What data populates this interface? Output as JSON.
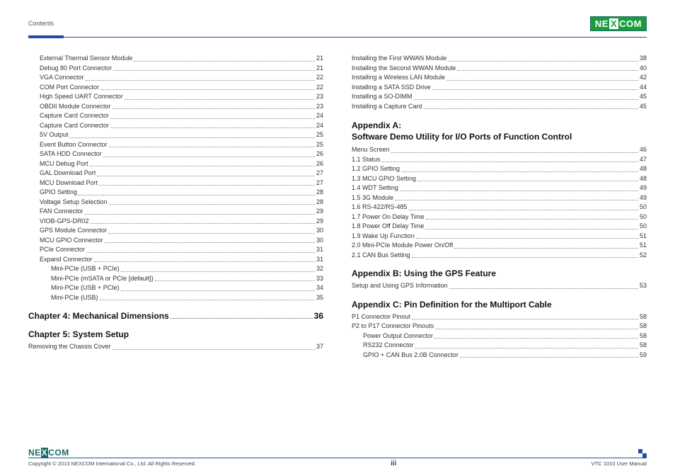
{
  "header": {
    "contents_label": "Contents",
    "brand": "NEXCOM"
  },
  "left_col": {
    "items": [
      {
        "label": "External Thermal Sensor Module",
        "page": "21",
        "indent": 1
      },
      {
        "label": "Debug 80 Port Connector",
        "page": "21",
        "indent": 1
      },
      {
        "label": "VGA Connector",
        "page": "22",
        "indent": 1
      },
      {
        "label": "COM Port Connector",
        "page": "22",
        "indent": 1
      },
      {
        "label": "High Speed UART Connector",
        "page": "23",
        "indent": 1
      },
      {
        "label": "OBDII Module Connector",
        "page": "23",
        "indent": 1
      },
      {
        "label": "Capture Card Connector",
        "page": "24",
        "indent": 1
      },
      {
        "label": "Capture Card Connector",
        "page": "24",
        "indent": 1
      },
      {
        "label": "5V Output",
        "page": "25",
        "indent": 1
      },
      {
        "label": "Event Button Connector",
        "page": "25",
        "indent": 1
      },
      {
        "label": "SATA HDD Connector",
        "page": "26",
        "indent": 1
      },
      {
        "label": "MCU Debug Port",
        "page": "26",
        "indent": 1
      },
      {
        "label": "GAL Download Port",
        "page": "27",
        "indent": 1
      },
      {
        "label": "MCU Download Port",
        "page": "27",
        "indent": 1
      },
      {
        "label": "GPIO Setting",
        "page": "28",
        "indent": 1
      },
      {
        "label": "Voltage Setup Selection",
        "page": "28",
        "indent": 1
      },
      {
        "label": "FAN Connector",
        "page": "29",
        "indent": 1
      },
      {
        "label": "VIOB-GPS-DR02",
        "page": "29",
        "indent": 1
      },
      {
        "label": "GPS Module Connector",
        "page": "30",
        "indent": 1
      },
      {
        "label": "MCU GPIO Connector",
        "page": "30",
        "indent": 1
      },
      {
        "label": "PCIe Connector",
        "page": "31",
        "indent": 1
      },
      {
        "label": "Expand Connector",
        "page": "31",
        "indent": 1
      },
      {
        "label": "Mini-PCIe (USB + PCIe)",
        "page": "32",
        "indent": 2
      },
      {
        "label": "Mini-PCIe (mSATA or PCIe [default])",
        "page": "33",
        "indent": 2
      },
      {
        "label": "Mini-PCIe (USB + PCIe)",
        "page": "34",
        "indent": 2
      },
      {
        "label": "Mini-PCIe (USB)",
        "page": "35",
        "indent": 2
      }
    ],
    "ch4": {
      "label": "Chapter 4: Mechanical Dimensions",
      "page": "36"
    },
    "ch5": {
      "label": "Chapter 5: System Setup"
    },
    "ch5_items": [
      {
        "label": "Removing the Chassis Cover",
        "page": "37",
        "indent": 0
      }
    ]
  },
  "right_col": {
    "head_items": [
      {
        "label": "Installing the First WWAN Module",
        "page": "38",
        "indent": 0
      },
      {
        "label": "Installing the Second WWAN Module",
        "page": "40",
        "indent": 0
      },
      {
        "label": "Installing a Wireless LAN Module",
        "page": "42",
        "indent": 0
      },
      {
        "label": "Installing a SATA SSD Drive",
        "page": "44",
        "indent": 0
      },
      {
        "label": "Installing a SO-DIMM",
        "page": "45",
        "indent": 0
      },
      {
        "label": "Installing a Capture Card",
        "page": "45",
        "indent": 0
      }
    ],
    "appA_line1": "Appendix A:",
    "appA_line2": "Software Demo Utility for I/O Ports of Function Control",
    "appA_items": [
      {
        "label": "Menu Screen",
        "page": "46",
        "indent": 0
      },
      {
        "label": "1.1  Status",
        "page": "47",
        "indent": 0
      },
      {
        "label": "1.2  GPIO Setting",
        "page": "48",
        "indent": 0
      },
      {
        "label": "1.3  MCU GPIO Setting",
        "page": "48",
        "indent": 0
      },
      {
        "label": "1.4  WDT Setting",
        "page": "49",
        "indent": 0
      },
      {
        "label": "1.5  3G Module",
        "page": "49",
        "indent": 0
      },
      {
        "label": "1.6  RS-422/RS-485",
        "page": "50",
        "indent": 0
      },
      {
        "label": "1.7  Power On Delay Time",
        "page": "50",
        "indent": 0
      },
      {
        "label": "1.8  Power Off Delay Time",
        "page": "50",
        "indent": 0
      },
      {
        "label": "1.9  Wake Up Function",
        "page": "51",
        "indent": 0
      },
      {
        "label": "2.0  Mini-PCIe Module Power On/Off",
        "page": "51",
        "indent": 0
      },
      {
        "label": "2.1  CAN Bus Setting",
        "page": "52",
        "indent": 0
      }
    ],
    "appB": {
      "label": "Appendix B: Using the GPS Feature"
    },
    "appB_items": [
      {
        "label": "Setup and Using GPS Information",
        "page": "53",
        "indent": 0
      }
    ],
    "appC": {
      "label": "Appendix C: Pin Definition for the Multiport Cable"
    },
    "appC_items": [
      {
        "label": "P1 Connector Pinout",
        "page": "58",
        "indent": 0
      },
      {
        "label": "P2 to P17 Connector Pinouts",
        "page": "58",
        "indent": 0
      },
      {
        "label": "Power Output Connector",
        "page": "58",
        "indent": 1
      },
      {
        "label": "RS232 Connector",
        "page": "58",
        "indent": 1
      },
      {
        "label": "GPIO + CAN Bus 2.0B Connector",
        "page": "59",
        "indent": 1
      }
    ]
  },
  "footer": {
    "brand": "NEXCOM",
    "copyright": "Copyright © 2013 NEXCOM International Co., Ltd. All Rights Reserved.",
    "page": "iii",
    "manual": "VTC 1010 User Manual"
  }
}
